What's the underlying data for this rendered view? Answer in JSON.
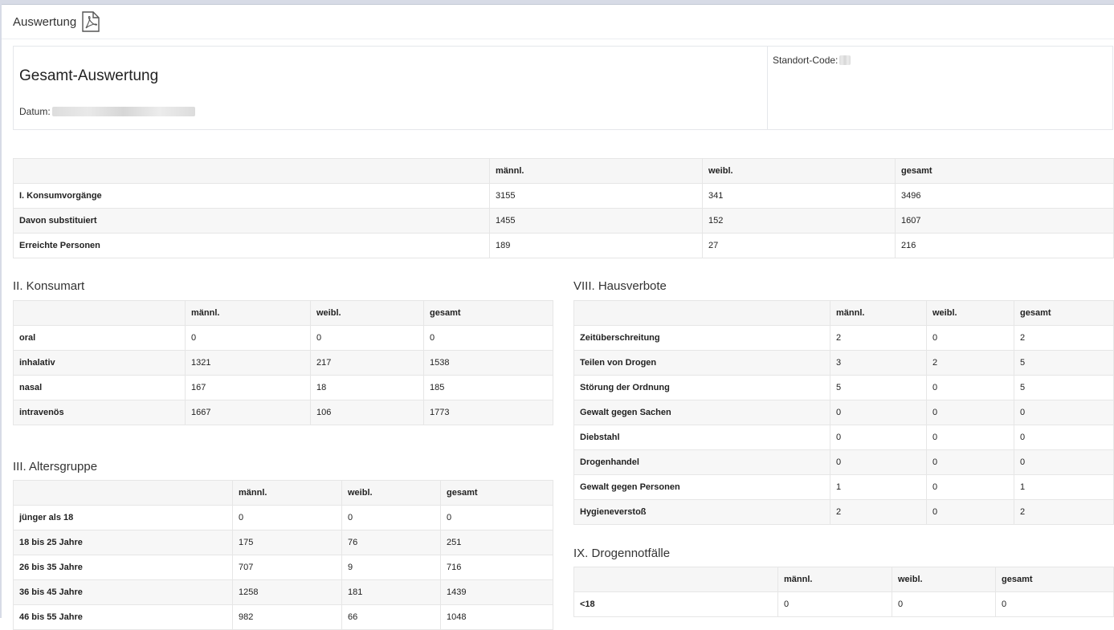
{
  "header": {
    "title": "Auswertung",
    "pdf_icon": "pdf-file-icon"
  },
  "info": {
    "heading": "Gesamt-Auswertung",
    "datum_label": "Datum:",
    "standort_label": "Standort-Code:"
  },
  "columns": {
    "m": "männl.",
    "w": "weibl.",
    "g": "gesamt"
  },
  "summary": {
    "rows": [
      {
        "label": "I. Konsumvorgänge",
        "m": "3155",
        "w": "341",
        "g": "3496"
      },
      {
        "label": "Davon substituiert",
        "m": "1455",
        "w": "152",
        "g": "1607"
      },
      {
        "label": "Erreichte Personen",
        "m": "189",
        "w": "27",
        "g": "216"
      }
    ]
  },
  "konsumart": {
    "title": "II. Konsumart",
    "rows": [
      {
        "label": "oral",
        "m": "0",
        "w": "0",
        "g": "0"
      },
      {
        "label": "inhalativ",
        "m": "1321",
        "w": "217",
        "g": "1538"
      },
      {
        "label": "nasal",
        "m": "167",
        "w": "18",
        "g": "185"
      },
      {
        "label": "intravenös",
        "m": "1667",
        "w": "106",
        "g": "1773"
      }
    ]
  },
  "altersgruppe": {
    "title": "III. Altersgruppe",
    "rows": [
      {
        "label": "jünger als 18",
        "m": "0",
        "w": "0",
        "g": "0"
      },
      {
        "label": "18 bis 25 Jahre",
        "m": "175",
        "w": "76",
        "g": "251"
      },
      {
        "label": "26 bis 35 Jahre",
        "m": "707",
        "w": "9",
        "g": "716"
      },
      {
        "label": "36 bis 45 Jahre",
        "m": "1258",
        "w": "181",
        "g": "1439"
      },
      {
        "label": "46 bis 55 Jahre",
        "m": "982",
        "w": "66",
        "g": "1048"
      }
    ]
  },
  "hausverbote": {
    "title": "VIII. Hausverbote",
    "rows": [
      {
        "label": "Zeitüberschreitung",
        "m": "2",
        "w": "0",
        "g": "2"
      },
      {
        "label": "Teilen von Drogen",
        "m": "3",
        "w": "2",
        "g": "5"
      },
      {
        "label": "Störung der Ordnung",
        "m": "5",
        "w": "0",
        "g": "5"
      },
      {
        "label": "Gewalt gegen Sachen",
        "m": "0",
        "w": "0",
        "g": "0"
      },
      {
        "label": "Diebstahl",
        "m": "0",
        "w": "0",
        "g": "0"
      },
      {
        "label": "Drogenhandel",
        "m": "0",
        "w": "0",
        "g": "0"
      },
      {
        "label": "Gewalt gegen Personen",
        "m": "1",
        "w": "0",
        "g": "1"
      },
      {
        "label": "Hygieneverstoß",
        "m": "2",
        "w": "0",
        "g": "2"
      }
    ]
  },
  "drogennotfaelle": {
    "title": "IX. Drogennotfälle",
    "rows": [
      {
        "label": "<18",
        "m": "0",
        "w": "0",
        "g": "0"
      }
    ]
  }
}
